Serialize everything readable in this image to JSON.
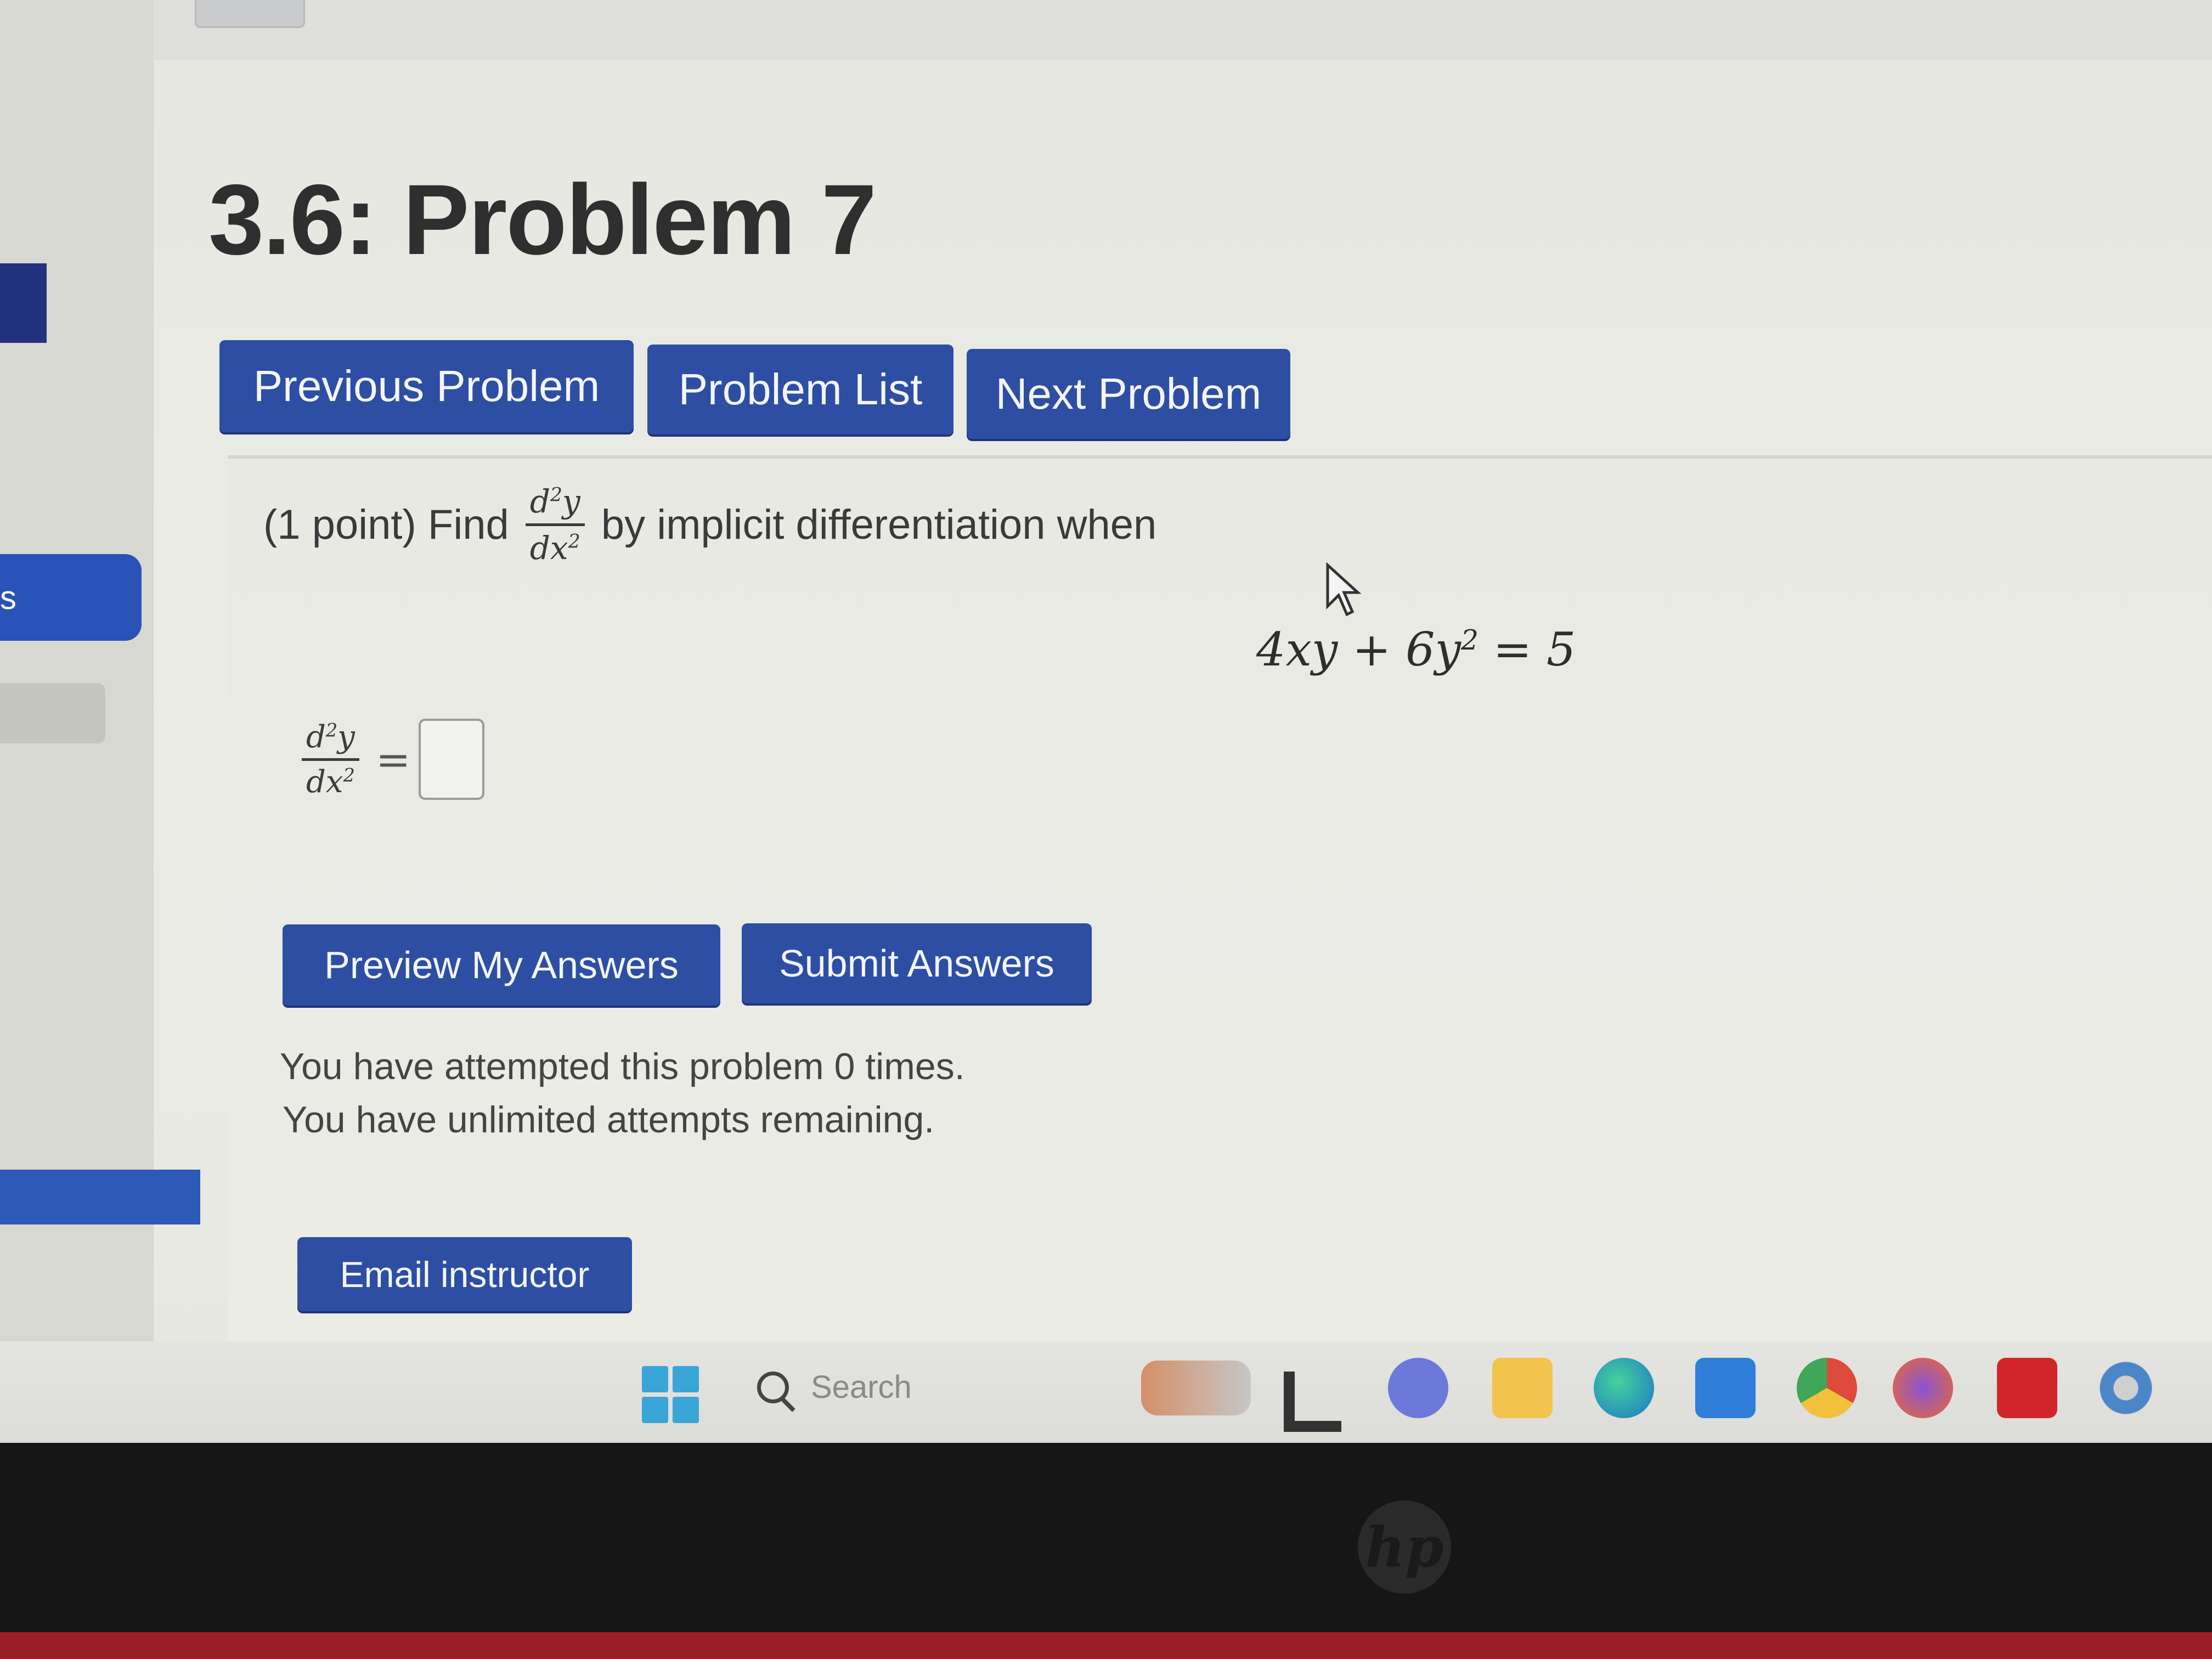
{
  "title": "3.6: Problem 7",
  "nav": {
    "previous": "Previous Problem",
    "list": "Problem List",
    "next": "Next Problem"
  },
  "problem": {
    "prefix": "(1 point) Find",
    "fraction_numerator": "d",
    "fraction_numerator_exp": "2",
    "fraction_numerator_var": "y",
    "fraction_denominator": "dx",
    "fraction_denominator_exp": "2",
    "suffix": "by implicit differentiation when",
    "equation_lhs": "4xy + 6y",
    "equation_exp": "2",
    "equation_rhs": " = 5"
  },
  "answer": {
    "equals": "=",
    "value": ""
  },
  "actions": {
    "preview": "Preview My Answers",
    "submit": "Submit Answers",
    "email": "Email instructor"
  },
  "status": {
    "attempted": "You have attempted this problem 0 times.",
    "remaining": "You have unlimited attempts remaining."
  },
  "sidebar": {
    "partial_label": "s"
  },
  "taskbar": {
    "search_placeholder": "Search",
    "icons": [
      "windows-start-icon",
      "search-icon",
      "widgets-icon",
      "l-app-icon",
      "teams-icon",
      "file-explorer-icon",
      "edge-icon",
      "store-icon",
      "chrome-icon",
      "firefox-icon",
      "acrobat-icon",
      "settings-icon"
    ]
  },
  "bezel": {
    "logo": "hp"
  },
  "colors": {
    "button_blue": "#2d4ea3",
    "sidebar_blue": "#2a53b8",
    "text": "#3a3a3a"
  }
}
